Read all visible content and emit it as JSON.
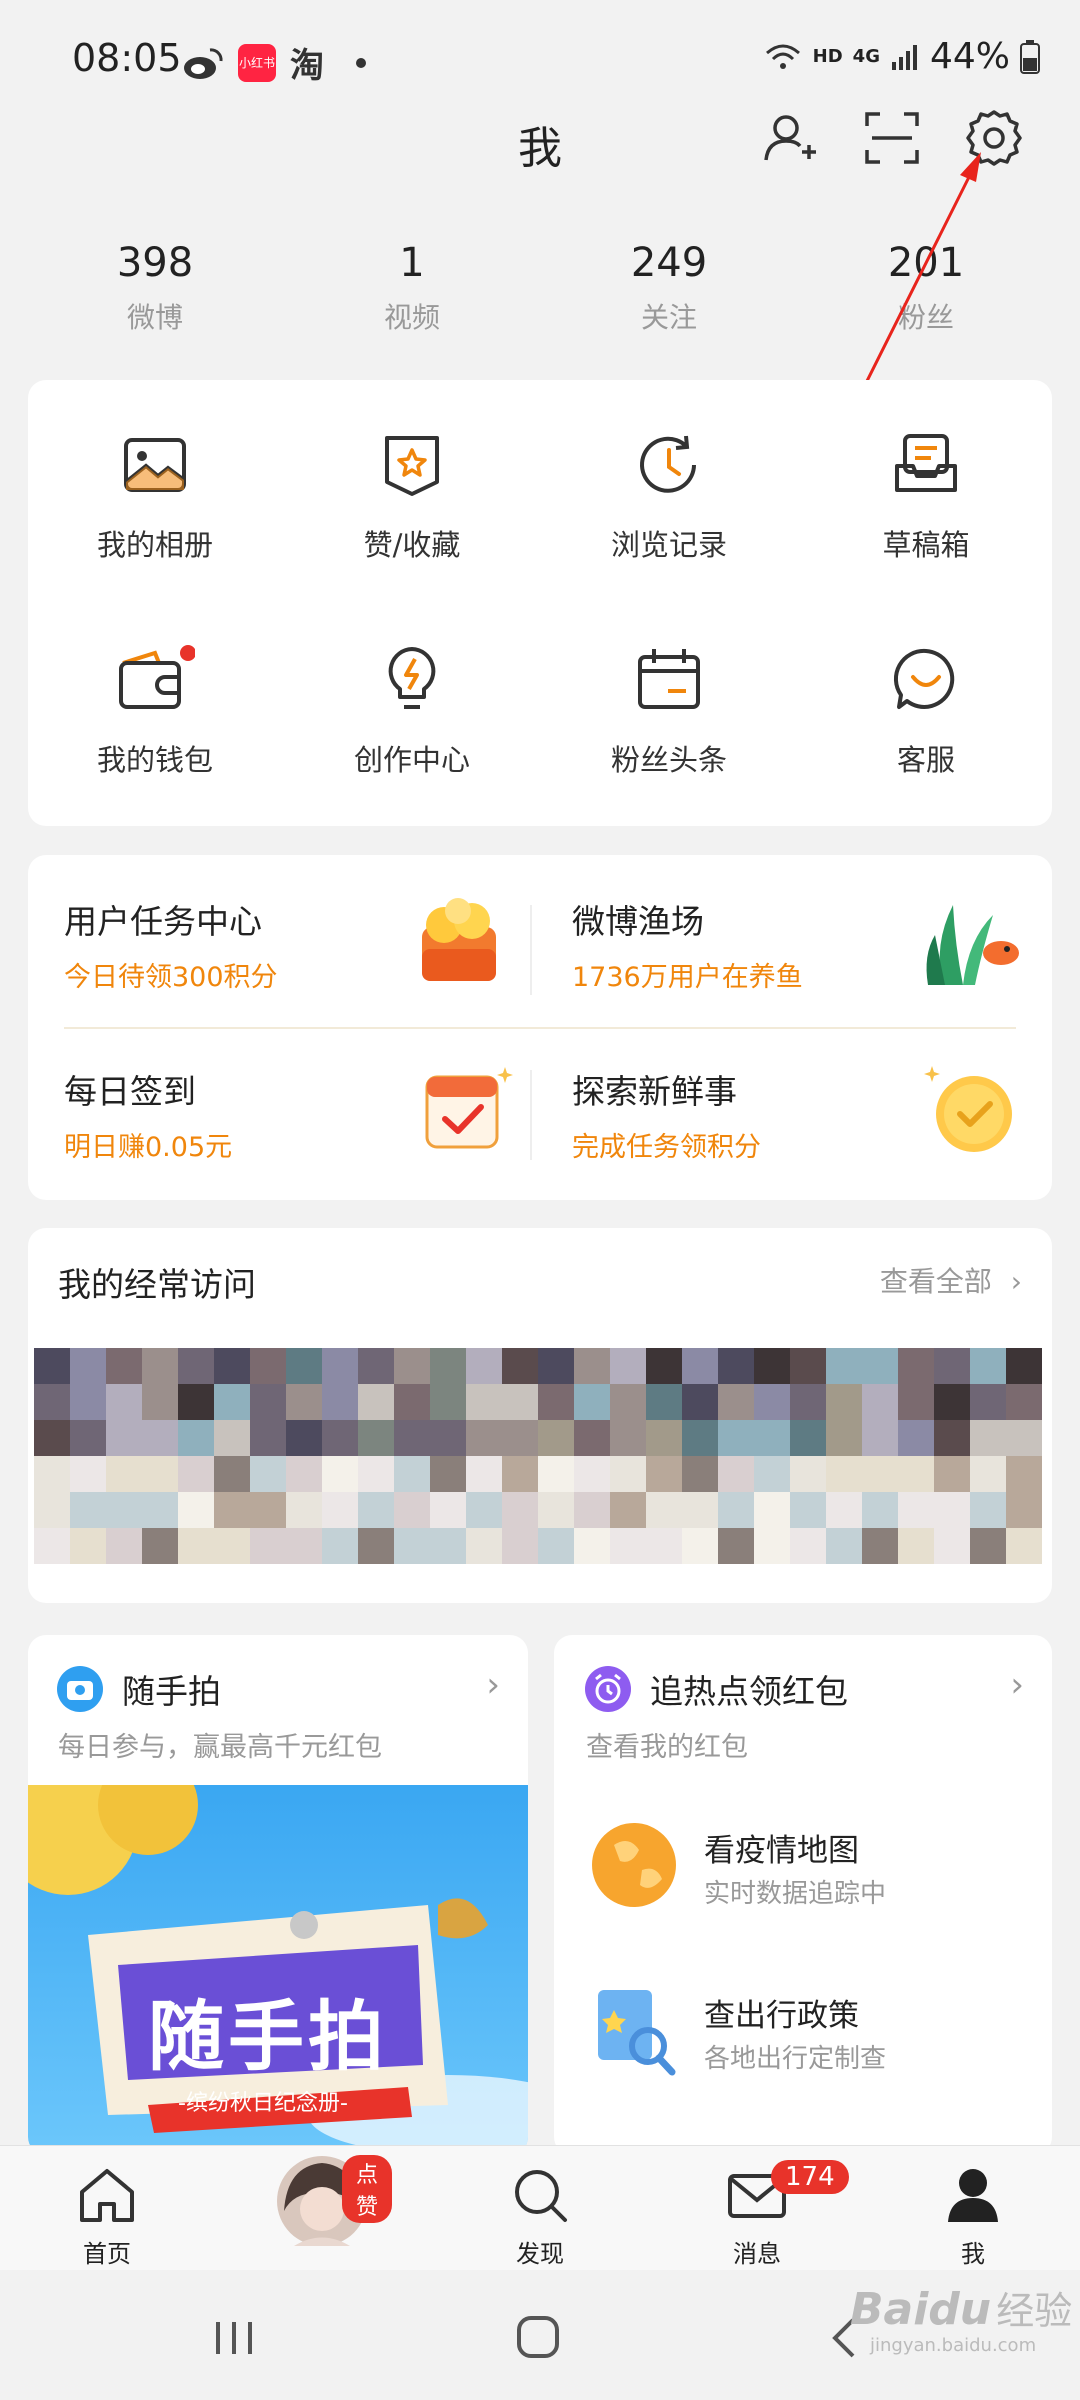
{
  "status": {
    "time": "08:05",
    "network": "HD",
    "signal": "4G",
    "battery": "44%",
    "app_badge_text": "小红书",
    "taobao_label": "淘"
  },
  "header": {
    "title": "我"
  },
  "stats": [
    {
      "num": "398",
      "label": "微博"
    },
    {
      "num": "1",
      "label": "视频"
    },
    {
      "num": "249",
      "label": "关注"
    },
    {
      "num": "201",
      "label": "粉丝"
    }
  ],
  "grid": [
    {
      "label": "我的相册",
      "icon": "photo-album-icon"
    },
    {
      "label": "赞/收藏",
      "icon": "favorite-icon"
    },
    {
      "label": "浏览记录",
      "icon": "history-icon"
    },
    {
      "label": "草稿箱",
      "icon": "drafts-icon"
    },
    {
      "label": "我的钱包",
      "icon": "wallet-icon"
    },
    {
      "label": "创作中心",
      "icon": "bulb-icon"
    },
    {
      "label": "粉丝头条",
      "icon": "calendar-icon"
    },
    {
      "label": "客服",
      "icon": "customer-service-icon"
    }
  ],
  "tasks": [
    {
      "title": "用户任务中心",
      "sub": "今日待领300积分"
    },
    {
      "title": "微博渔场",
      "sub": "1736万用户在养鱼"
    },
    {
      "title": "每日签到",
      "sub": "明日赚0.05元"
    },
    {
      "title": "探索新鲜事",
      "sub": "完成任务领积分"
    }
  ],
  "frequent": {
    "title": "我的经常访问",
    "view_all": "查看全部"
  },
  "snap": {
    "title": "随手拍",
    "sub": "每日参与，赢最高千元红包",
    "banner_title": "随手拍",
    "banner_sub": "-缤纷秋日纪念册-"
  },
  "redpacket": {
    "title": "追热点领红包",
    "sub": "查看我的红包",
    "items": [
      {
        "title": "看疫情地图",
        "sub": "实时数据追踪中"
      },
      {
        "title": "查出行政策",
        "sub": "各地出行定制查"
      }
    ]
  },
  "tabs": [
    {
      "label": "首页"
    },
    {
      "label": "点赞"
    },
    {
      "label": "发现"
    },
    {
      "label": "消息",
      "badge": "174"
    },
    {
      "label": "我"
    }
  ],
  "watermark": {
    "brand": "Baidu",
    "cn": "经验",
    "url": "jingyan.baidu.com"
  },
  "colors": {
    "accent": "#f0860c",
    "badge_red": "#e8332a",
    "annotation_arrow": "#e8241c"
  }
}
